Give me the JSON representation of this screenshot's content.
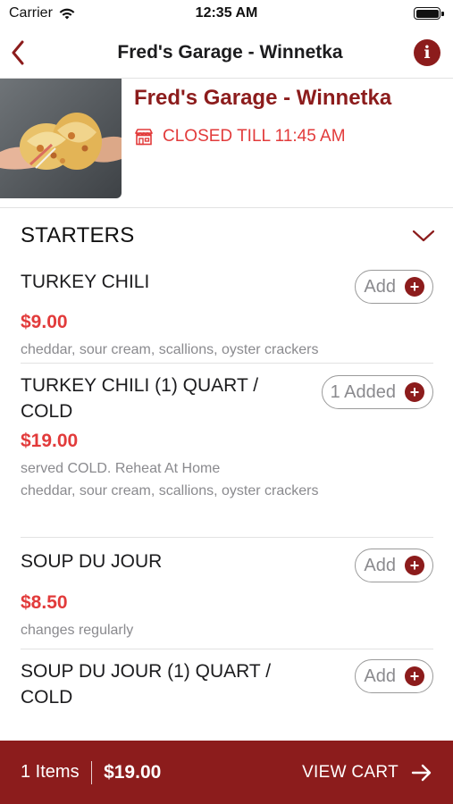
{
  "status_bar": {
    "carrier": "Carrier",
    "time": "12:35 AM"
  },
  "nav": {
    "title": "Fred's Garage - Winnetka",
    "info_glyph": "i"
  },
  "header": {
    "name": "Fred's Garage - Winnetka",
    "status": "CLOSED TILL 11:45 AM"
  },
  "section": {
    "title": "STARTERS"
  },
  "items": [
    {
      "name": "TURKEY CHILI",
      "price": "$9.00",
      "desc": "cheddar, sour cream, scallions, oyster crackers",
      "button": "Add"
    },
    {
      "name": "TURKEY CHILI (1) QUART /",
      "name2": "COLD",
      "price": "$19.00",
      "desc": "served COLD. Reheat At Home",
      "desc2": "cheddar, sour cream, scallions, oyster crackers",
      "button": "1 Added"
    },
    {
      "name": "SOUP DU JOUR",
      "price": "$8.50",
      "desc": "changes regularly",
      "button": "Add"
    },
    {
      "name": "SOUP DU JOUR (1) QUART /",
      "name2": "COLD",
      "button": "Add"
    }
  ],
  "cart": {
    "count": "1 Items",
    "total": "$19.00",
    "action": "VIEW CART"
  },
  "colors": {
    "brand": "#8c1c1c",
    "price": "#e23b3b"
  },
  "icons": [
    "wifi-icon",
    "battery-icon",
    "back-chevron-icon",
    "info-icon",
    "store-icon",
    "chevron-down-icon",
    "plus-icon",
    "arrow-right-icon"
  ]
}
